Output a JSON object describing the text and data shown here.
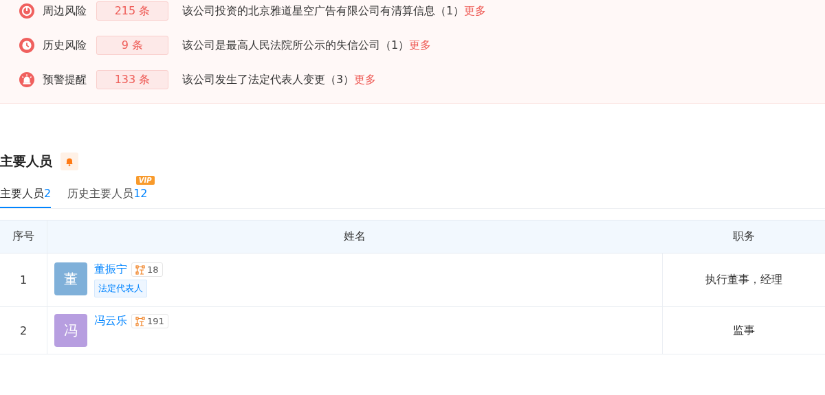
{
  "risks": [
    {
      "kind": "nearby",
      "label": "周边风险",
      "count": "215 条",
      "text": "该公司投资的北京雅道星空广告有限公司有清算信息（1）",
      "more": "更多"
    },
    {
      "kind": "history",
      "label": "历史风险",
      "count": "9 条",
      "text": "该公司是最高人民法院所公示的失信公司（1）",
      "more": "更多"
    },
    {
      "kind": "alert",
      "label": "预警提醒",
      "count": "133 条",
      "text": "该公司发生了法定代表人变更（3）",
      "more": "更多"
    }
  ],
  "section": {
    "title": "主要人员"
  },
  "tabs": [
    {
      "label": "主要人员",
      "count": "2",
      "selected": true
    },
    {
      "label": "历史主要人员",
      "count": "12",
      "selected": false,
      "badge": "VIP"
    }
  ],
  "table": {
    "columns": [
      "序号",
      "姓名",
      "职务"
    ],
    "rows": [
      {
        "index": "1",
        "avatar": "董",
        "color": "#7fb0d9",
        "name": "董振宁",
        "relations": "18",
        "tag": "法定代表人",
        "role": "执行董事，经理"
      },
      {
        "index": "2",
        "avatar": "冯",
        "color": "#b79ee0",
        "name": "冯云乐",
        "relations": "191",
        "role": "监事"
      }
    ]
  }
}
